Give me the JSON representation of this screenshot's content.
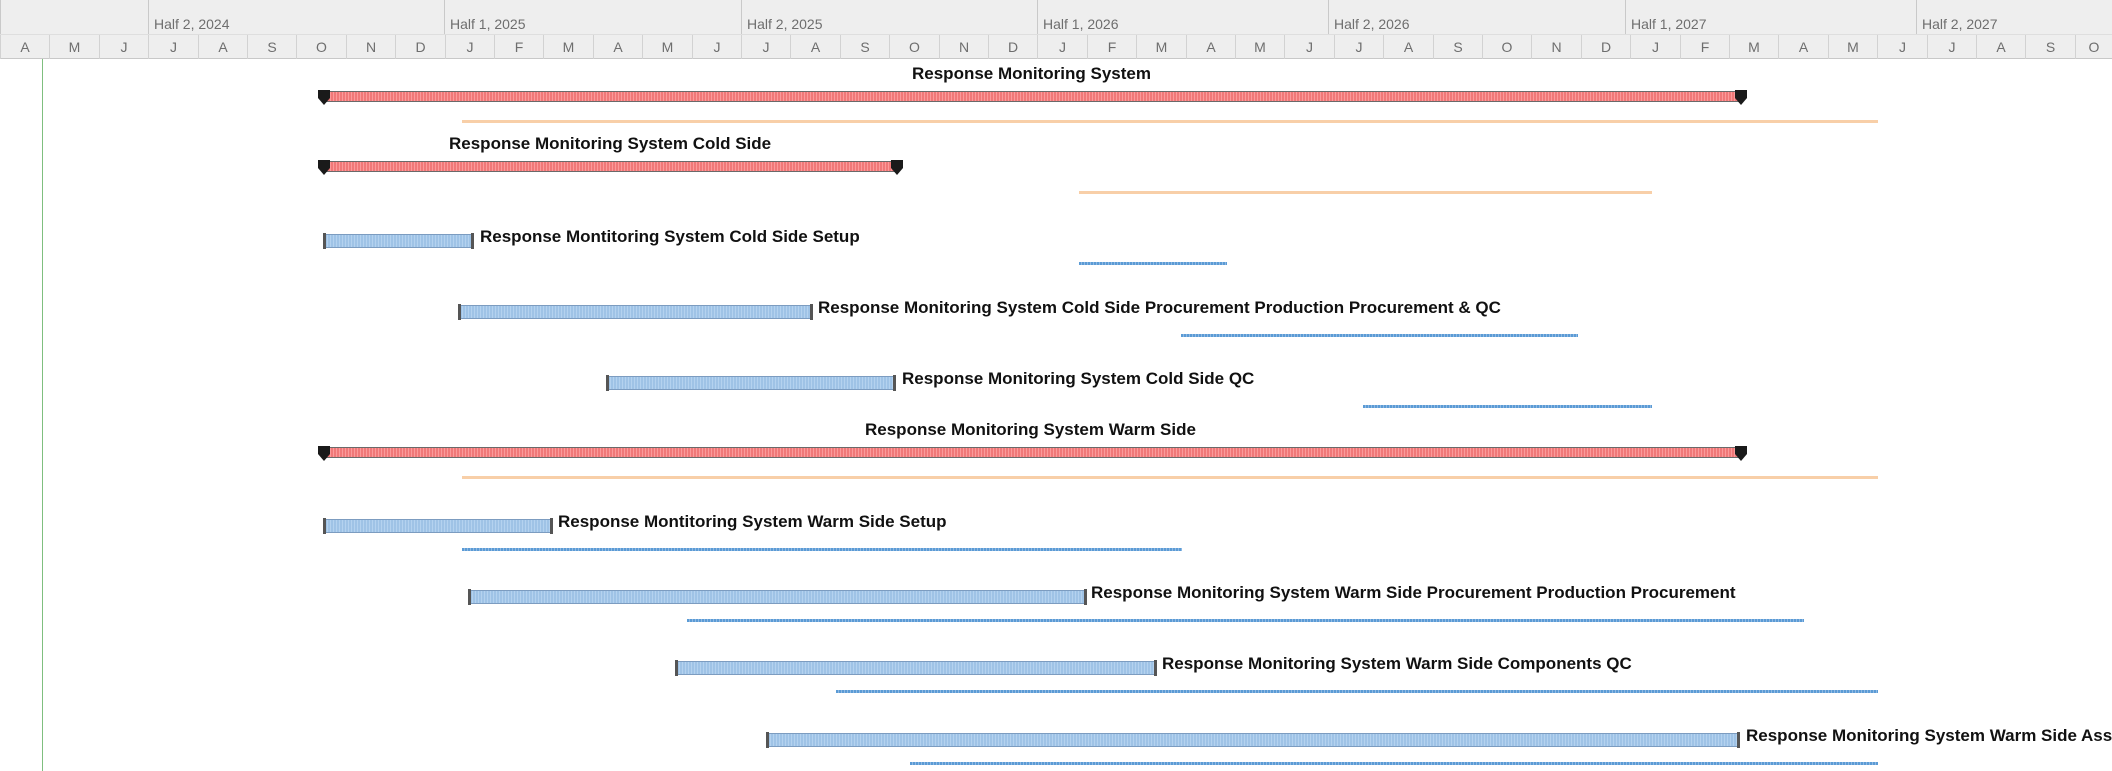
{
  "timescale": {
    "halves": [
      {
        "label": ""
      },
      {
        "label": "Half 2, 2024"
      },
      {
        "label": "Half 1, 2025"
      },
      {
        "label": "Half 2, 2025"
      },
      {
        "label": "Half 1, 2026"
      },
      {
        "label": "Half 2, 2026"
      },
      {
        "label": "Half 1, 2027"
      },
      {
        "label": "Half 2, 2027"
      }
    ],
    "months": [
      "A",
      "M",
      "J",
      "J",
      "A",
      "S",
      "O",
      "N",
      "D",
      "J",
      "F",
      "M",
      "A",
      "M",
      "J",
      "J",
      "A",
      "S",
      "O",
      "N",
      "D",
      "J",
      "F",
      "M",
      "A",
      "M",
      "J",
      "J",
      "A",
      "S",
      "O",
      "N",
      "D",
      "J",
      "F",
      "M",
      "A",
      "M",
      "J",
      "J",
      "A",
      "S",
      "O"
    ]
  },
  "tasks": [
    {
      "name": "Response Monitoring System",
      "type": "summary"
    },
    {
      "name": "Response Monitoring System Cold Side",
      "type": "summary"
    },
    {
      "name": "Response Montitoring System Cold Side Setup",
      "type": "task"
    },
    {
      "name": "Response Monitoring System Cold Side Procurement Production Procurement & QC",
      "type": "task"
    },
    {
      "name": "Response Monitoring System Cold Side QC",
      "type": "task"
    },
    {
      "name": "Response Monitoring System Warm Side",
      "type": "summary"
    },
    {
      "name": "Response Montitoring System Warm Side Setup",
      "type": "task"
    },
    {
      "name": "Response Monitoring System Warm Side Procurement Production Procurement",
      "type": "task"
    },
    {
      "name": "Response Monitoring System Warm Side Components QC",
      "type": "task"
    },
    {
      "name": "Response Monitoring System Warm Side Ass",
      "type": "task"
    }
  ],
  "colors": {
    "summary_bar": "#f07878",
    "task_bar": "#9fc3e6",
    "baseline_summary": "#f8cfa8",
    "baseline_task": "#5b9bd5",
    "status_line": "#7fbf7f"
  }
}
